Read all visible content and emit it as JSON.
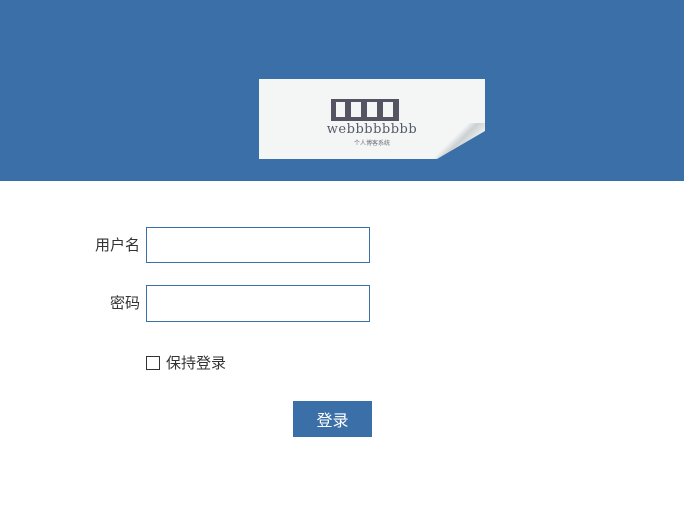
{
  "header": {
    "background_color": "#3a6fa8",
    "logo": {
      "icon": "piano-keys-logo-icon",
      "brand_text": "webbbbbbbb",
      "sub_text": "个人博客系统"
    }
  },
  "form": {
    "username": {
      "label": "用户名",
      "value": "",
      "placeholder": ""
    },
    "password": {
      "label": "密码",
      "value": "",
      "placeholder": ""
    },
    "remember": {
      "label": "保持登录",
      "checked": false
    },
    "submit_label": "登录"
  }
}
